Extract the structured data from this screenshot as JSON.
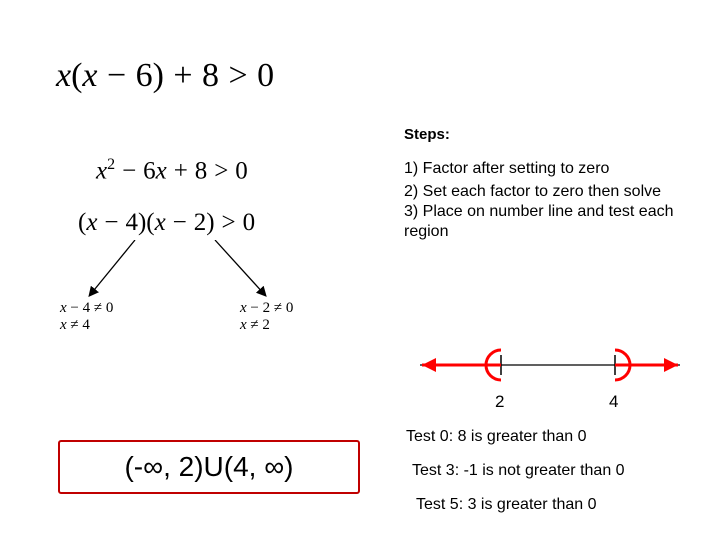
{
  "main_inequality": "x(x − 6) + 8 > 0",
  "expanded": "x² − 6x + 8 > 0",
  "factored": "(x − 4)(x − 2) > 0",
  "steps_heading": "Steps:",
  "step1": "1) Factor after setting to zero",
  "step23": "2) Set each factor to zero then solve\n3) Place on number line and test each region",
  "sub_left_line1": "x − 4 ≠ 0",
  "sub_left_line2": "x ≠ 4",
  "sub_right_line1": "x − 2 ≠ 0",
  "sub_right_line2": "x ≠ 2",
  "tick_a": "2",
  "tick_b": "4",
  "test0": "Test 0:  8 is greater than 0",
  "test3": "Test 3:  -1 is not greater than 0",
  "test5": "Test 5:  3 is greater than 0",
  "answer": "(-∞, 2)U(4, ∞)",
  "colors": {
    "answer_border": "#c00000",
    "numberline_red": "#ff0000"
  }
}
